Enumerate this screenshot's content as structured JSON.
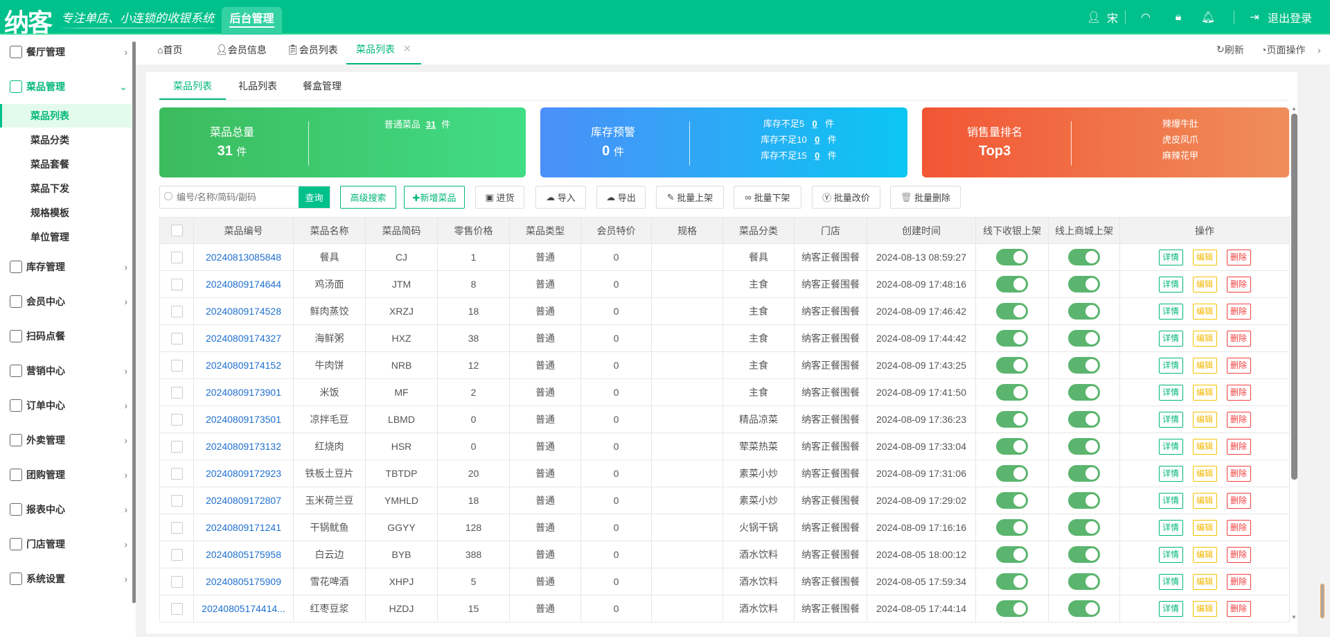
{
  "header": {
    "logo": "纳客",
    "slogan": "专注单店、小连锁的收银系统",
    "admin_tab": "后台管理",
    "user": "宋",
    "logout": "退出登录"
  },
  "sidebar": {
    "items": [
      {
        "label": "餐厅管理",
        "icon": "restaurant-icon"
      },
      {
        "label": "菜品管理",
        "icon": "dish-icon",
        "open": true,
        "children": [
          "菜品列表",
          "菜品分类",
          "菜品套餐",
          "菜品下发",
          "规格模板",
          "单位管理"
        ],
        "active_child": "菜品列表"
      },
      {
        "label": "库存管理",
        "icon": "inventory-icon"
      },
      {
        "label": "会员中心",
        "icon": "crown-icon"
      },
      {
        "label": "扫码点餐",
        "icon": "user-icon"
      },
      {
        "label": "营销中心",
        "icon": "target-icon"
      },
      {
        "label": "订单中心",
        "icon": "globe-icon"
      },
      {
        "label": "外卖管理",
        "icon": "delivery-icon"
      },
      {
        "label": "团购管理",
        "icon": "calendar-icon"
      },
      {
        "label": "报表中心",
        "icon": "chart-icon"
      },
      {
        "label": "门店管理",
        "icon": "store-icon"
      },
      {
        "label": "系统设置",
        "icon": "gear-icon"
      }
    ]
  },
  "tabs": {
    "items": [
      "首页",
      "会员信息",
      "会员列表",
      "菜品列表"
    ],
    "active": "菜品列表",
    "refresh": "刷新",
    "page_ops": "页面操作"
  },
  "inner_tabs": [
    "菜品列表",
    "礼品列表",
    "餐盒管理"
  ],
  "cards": {
    "total": {
      "title": "菜品总量",
      "value": "31",
      "unit": "件",
      "normal_label": "普通菜品",
      "normal_value": "31",
      "normal_unit": "件"
    },
    "stock": {
      "title": "库存预警",
      "value": "0",
      "unit": "件",
      "lines": [
        {
          "label": "库存不足5",
          "value": "0",
          "unit": "件"
        },
        {
          "label": "库存不足10",
          "value": "0",
          "unit": "件"
        },
        {
          "label": "库存不足15",
          "value": "0",
          "unit": "件"
        }
      ]
    },
    "sales": {
      "title": "销售量排名",
      "value": "Top3",
      "items": [
        "辣爆牛肚",
        "虎皮凤爪",
        "麻辣花甲"
      ]
    }
  },
  "toolbar": {
    "search_placeholder": "编号/名称/简码/副码",
    "query": "查询",
    "advanced": "高级搜索",
    "add": "✚新增菜品",
    "purchase": "进货",
    "import": "导入",
    "export": "导出",
    "batch_on": "批量上架",
    "batch_off": "批量下架",
    "batch_price": "批量改价",
    "batch_delete": "批量删除"
  },
  "table": {
    "columns": [
      "菜品编号",
      "菜品名称",
      "菜品简码",
      "零售价格",
      "菜品类型",
      "会员特价",
      "规格",
      "菜品分类",
      "门店",
      "创建时间",
      "线下收银上架",
      "线上商城上架",
      "操作"
    ],
    "actions": {
      "detail": "详情",
      "edit": "编辑",
      "delete": "删除"
    },
    "rows": [
      [
        "20240813085848",
        "餐具",
        "CJ",
        "1",
        "普通",
        "0",
        "",
        "餐具",
        "纳客正餐围餐",
        "2024-08-13 08:59:27"
      ],
      [
        "20240809174644",
        "鸡汤面",
        "JTM",
        "8",
        "普通",
        "0",
        "",
        "主食",
        "纳客正餐围餐",
        "2024-08-09 17:48:16"
      ],
      [
        "20240809174528",
        "鲜肉蒸饺",
        "XRZJ",
        "18",
        "普通",
        "0",
        "",
        "主食",
        "纳客正餐围餐",
        "2024-08-09 17:46:42"
      ],
      [
        "20240809174327",
        "海鲜粥",
        "HXZ",
        "38",
        "普通",
        "0",
        "",
        "主食",
        "纳客正餐围餐",
        "2024-08-09 17:44:42"
      ],
      [
        "20240809174152",
        "牛肉饼",
        "NRB",
        "12",
        "普通",
        "0",
        "",
        "主食",
        "纳客正餐围餐",
        "2024-08-09 17:43:25"
      ],
      [
        "20240809173901",
        "米饭",
        "MF",
        "2",
        "普通",
        "0",
        "",
        "主食",
        "纳客正餐围餐",
        "2024-08-09 17:41:50"
      ],
      [
        "20240809173501",
        "凉拌毛豆",
        "LBMD",
        "0",
        "普通",
        "0",
        "",
        "精品凉菜",
        "纳客正餐围餐",
        "2024-08-09 17:36:23"
      ],
      [
        "20240809173132",
        "红烧肉",
        "HSR",
        "0",
        "普通",
        "0",
        "",
        "荤菜热菜",
        "纳客正餐围餐",
        "2024-08-09 17:33:04"
      ],
      [
        "20240809172923",
        "铁板土豆片",
        "TBTDP",
        "20",
        "普通",
        "0",
        "",
        "素菜小炒",
        "纳客正餐围餐",
        "2024-08-09 17:31:06"
      ],
      [
        "20240809172807",
        "玉米荷兰豆",
        "YMHLD",
        "18",
        "普通",
        "0",
        "",
        "素菜小炒",
        "纳客正餐围餐",
        "2024-08-09 17:29:02"
      ],
      [
        "20240809171241",
        "干锅鱿鱼",
        "GGYY",
        "128",
        "普通",
        "0",
        "",
        "火锅干锅",
        "纳客正餐围餐",
        "2024-08-09 17:16:16"
      ],
      [
        "20240805175958",
        "白云边",
        "BYB",
        "388",
        "普通",
        "0",
        "",
        "酒水饮料",
        "纳客正餐围餐",
        "2024-08-05 18:00:12"
      ],
      [
        "20240805175909",
        "雪花啤酒",
        "XHPJ",
        "5",
        "普通",
        "0",
        "",
        "酒水饮料",
        "纳客正餐围餐",
        "2024-08-05 17:59:34"
      ],
      [
        "20240805174414...",
        "红枣豆浆",
        "HZDJ",
        "15",
        "普通",
        "0",
        "",
        "酒水饮料",
        "纳客正餐围餐",
        "2024-08-05 17:44:14"
      ]
    ]
  }
}
